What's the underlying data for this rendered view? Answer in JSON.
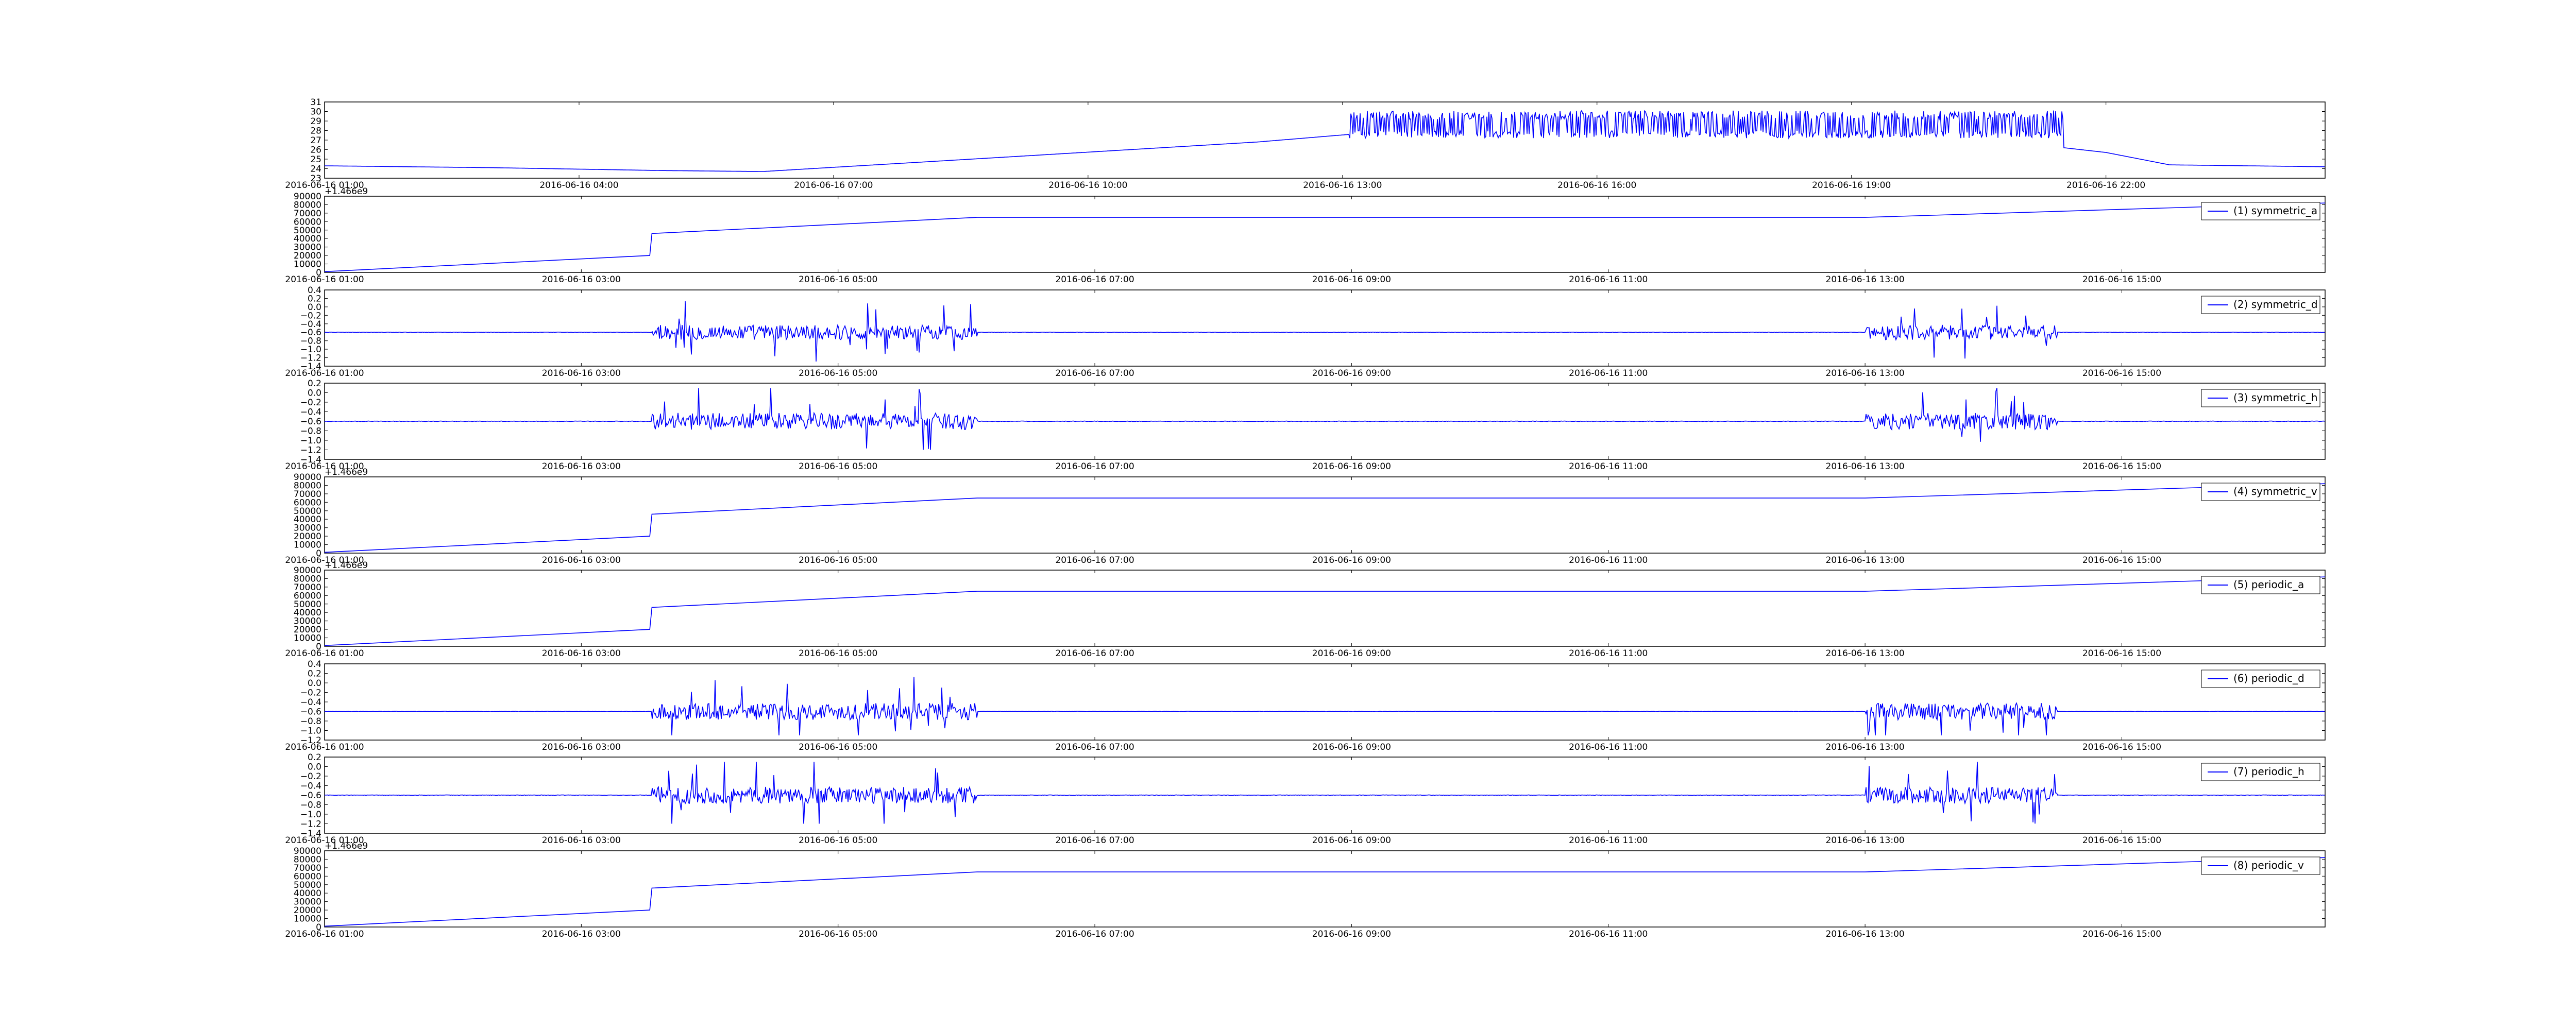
{
  "colors": {
    "line": "#0000ff",
    "axes": "#000000",
    "background": "#ffffff"
  },
  "chart_data": [
    {
      "type": "line",
      "series_shape": "temperature",
      "xlabel": "",
      "ylabel": "",
      "ylim": [
        23,
        31
      ],
      "yticks": [
        23,
        24,
        25,
        26,
        27,
        28,
        29,
        30,
        31
      ],
      "xlim": [
        "2016-06-16 01:00",
        "2016-06-17 00:35"
      ],
      "xticks": [
        "2016-06-16 01:00",
        "2016-06-16 04:00",
        "2016-06-16 07:00",
        "2016-06-16 10:00",
        "2016-06-16 13:00",
        "2016-06-16 16:00",
        "2016-06-16 19:00",
        "2016-06-16 22:00"
      ],
      "legend": null,
      "grid": false,
      "x": [
        "2016-06-16 01:00",
        "2016-06-16 03:00",
        "2016-06-16 05:00",
        "2016-06-16 06:10",
        "2016-06-16 09:00",
        "2016-06-16 12:00",
        "2016-06-16 13:05",
        "2016-06-16 17:00",
        "2016-06-16 20:30",
        "2016-06-16 21:30",
        "2016-06-16 22:00",
        "2016-06-16 22:45",
        "2016-06-17 00:35"
      ],
      "values": [
        24.3,
        24.1,
        23.8,
        23.7,
        25.2,
        26.8,
        27.6,
        28.5,
        28.8,
        26.2,
        25.7,
        24.4,
        24.2
      ]
    },
    {
      "type": "line",
      "series_shape": "ramp",
      "offset_label": "+1.466e9",
      "ylim": [
        0,
        90000
      ],
      "yticks": [
        0,
        10000,
        20000,
        30000,
        40000,
        50000,
        60000,
        70000,
        80000,
        90000
      ],
      "xlim": [
        "2016-06-16 01:00",
        "2016-06-16 16:35"
      ],
      "xticks": [
        "2016-06-16 01:00",
        "2016-06-16 03:00",
        "2016-06-16 05:00",
        "2016-06-16 07:00",
        "2016-06-16 09:00",
        "2016-06-16 11:00",
        "2016-06-16 13:00",
        "2016-06-16 15:00"
      ],
      "legend": {
        "label": "(1) symmetric_a",
        "position": "upper-right"
      },
      "x": [
        "2016-06-16 01:00",
        "2016-06-16 03:32",
        "2016-06-16 03:33",
        "2016-06-16 06:05",
        "2016-06-16 13:00",
        "2016-06-16 16:35"
      ],
      "values": [
        1000,
        20000,
        46000,
        65000,
        65000,
        82000
      ]
    },
    {
      "type": "line",
      "series_shape": "noise",
      "ylim": [
        -1.4,
        0.4
      ],
      "yticks": [
        -1.4,
        -1.2,
        -1.0,
        -0.8,
        -0.6,
        -0.4,
        -0.2,
        0.0,
        0.2,
        0.4
      ],
      "xlim": [
        "2016-06-16 01:00",
        "2016-06-16 16:35"
      ],
      "xticks": [
        "2016-06-16 01:00",
        "2016-06-16 03:00",
        "2016-06-16 05:00",
        "2016-06-16 07:00",
        "2016-06-16 09:00",
        "2016-06-16 11:00",
        "2016-06-16 13:00",
        "2016-06-16 15:00"
      ],
      "legend": {
        "label": "(2) symmetric_d",
        "position": "upper-right"
      },
      "baseline": -0.6,
      "active_ranges": [
        [
          "2016-06-16 03:33",
          "2016-06-16 06:05"
        ],
        [
          "2016-06-16 13:00",
          "2016-06-16 14:30"
        ]
      ],
      "peak_max": 0.2,
      "peak_min": -1.3
    },
    {
      "type": "line",
      "series_shape": "noise",
      "ylim": [
        -1.4,
        0.2
      ],
      "yticks": [
        -1.4,
        -1.2,
        -1.0,
        -0.8,
        -0.6,
        -0.4,
        -0.2,
        0.0,
        0.2
      ],
      "xlim": [
        "2016-06-16 01:00",
        "2016-06-16 16:35"
      ],
      "xticks": [
        "2016-06-16 01:00",
        "2016-06-16 03:00",
        "2016-06-16 05:00",
        "2016-06-16 07:00",
        "2016-06-16 09:00",
        "2016-06-16 11:00",
        "2016-06-16 13:00",
        "2016-06-16 15:00"
      ],
      "legend": {
        "label": "(3) symmetric_h",
        "position": "upper-right"
      },
      "baseline": -0.6,
      "active_ranges": [
        [
          "2016-06-16 03:33",
          "2016-06-16 06:05"
        ],
        [
          "2016-06-16 13:00",
          "2016-06-16 14:30"
        ]
      ],
      "peak_max": 0.1,
      "peak_min": -1.2
    },
    {
      "type": "line",
      "series_shape": "ramp",
      "offset_label": "+1.466e9",
      "ylim": [
        0,
        90000
      ],
      "yticks": [
        0,
        10000,
        20000,
        30000,
        40000,
        50000,
        60000,
        70000,
        80000,
        90000
      ],
      "xlim": [
        "2016-06-16 01:00",
        "2016-06-16 16:35"
      ],
      "xticks": [
        "2016-06-16 01:00",
        "2016-06-16 03:00",
        "2016-06-16 05:00",
        "2016-06-16 07:00",
        "2016-06-16 09:00",
        "2016-06-16 11:00",
        "2016-06-16 13:00",
        "2016-06-16 15:00"
      ],
      "legend": {
        "label": "(4) symmetric_v",
        "position": "upper-right"
      },
      "x": [
        "2016-06-16 01:00",
        "2016-06-16 03:32",
        "2016-06-16 03:33",
        "2016-06-16 06:05",
        "2016-06-16 13:00",
        "2016-06-16 16:35"
      ],
      "values": [
        1000,
        20000,
        46000,
        65000,
        65000,
        82000
      ]
    },
    {
      "type": "line",
      "series_shape": "ramp",
      "offset_label": "+1.466e9",
      "ylim": [
        0,
        90000
      ],
      "yticks": [
        0,
        10000,
        20000,
        30000,
        40000,
        50000,
        60000,
        70000,
        80000,
        90000
      ],
      "xlim": [
        "2016-06-16 01:00",
        "2016-06-16 16:35"
      ],
      "xticks": [
        "2016-06-16 01:00",
        "2016-06-16 03:00",
        "2016-06-16 05:00",
        "2016-06-16 07:00",
        "2016-06-16 09:00",
        "2016-06-16 11:00",
        "2016-06-16 13:00",
        "2016-06-16 15:00"
      ],
      "legend": {
        "label": "(5) periodic_a",
        "position": "upper-right"
      },
      "x": [
        "2016-06-16 01:00",
        "2016-06-16 03:32",
        "2016-06-16 03:33",
        "2016-06-16 06:05",
        "2016-06-16 13:00",
        "2016-06-16 16:35"
      ],
      "values": [
        1000,
        20000,
        46000,
        65000,
        65000,
        82000
      ]
    },
    {
      "type": "line",
      "series_shape": "noise",
      "ylim": [
        -1.2,
        0.4
      ],
      "yticks": [
        -1.2,
        -1.0,
        -0.8,
        -0.6,
        -0.4,
        -0.2,
        0.0,
        0.2,
        0.4
      ],
      "xlim": [
        "2016-06-16 01:00",
        "2016-06-16 16:35"
      ],
      "xticks": [
        "2016-06-16 01:00",
        "2016-06-16 03:00",
        "2016-06-16 05:00",
        "2016-06-16 07:00",
        "2016-06-16 09:00",
        "2016-06-16 11:00",
        "2016-06-16 13:00",
        "2016-06-16 15:00"
      ],
      "legend": {
        "label": "(6) periodic_d",
        "position": "upper-right"
      },
      "baseline": -0.6,
      "active_ranges": [
        [
          "2016-06-16 03:33",
          "2016-06-16 06:05"
        ],
        [
          "2016-06-16 13:00",
          "2016-06-16 14:30"
        ]
      ],
      "peak_max": 0.3,
      "peak_min": -1.1
    },
    {
      "type": "line",
      "series_shape": "noise",
      "ylim": [
        -1.4,
        0.2
      ],
      "yticks": [
        -1.4,
        -1.2,
        -1.0,
        -0.8,
        -0.6,
        -0.4,
        -0.2,
        0.0,
        0.2
      ],
      "xlim": [
        "2016-06-16 01:00",
        "2016-06-16 16:35"
      ],
      "xticks": [
        "2016-06-16 01:00",
        "2016-06-16 03:00",
        "2016-06-16 05:00",
        "2016-06-16 07:00",
        "2016-06-16 09:00",
        "2016-06-16 11:00",
        "2016-06-16 13:00",
        "2016-06-16 15:00"
      ],
      "legend": {
        "label": "(7) periodic_h",
        "position": "upper-right"
      },
      "baseline": -0.6,
      "active_ranges": [
        [
          "2016-06-16 03:33",
          "2016-06-16 06:05"
        ],
        [
          "2016-06-16 13:00",
          "2016-06-16 14:30"
        ]
      ],
      "peak_max": 0.1,
      "peak_min": -1.2
    },
    {
      "type": "line",
      "series_shape": "ramp",
      "offset_label": "+1.466e9",
      "ylim": [
        0,
        90000
      ],
      "yticks": [
        0,
        10000,
        20000,
        30000,
        40000,
        50000,
        60000,
        70000,
        80000,
        90000
      ],
      "xlim": [
        "2016-06-16 01:00",
        "2016-06-16 16:35"
      ],
      "xticks": [
        "2016-06-16 01:00",
        "2016-06-16 03:00",
        "2016-06-16 05:00",
        "2016-06-16 07:00",
        "2016-06-16 09:00",
        "2016-06-16 11:00",
        "2016-06-16 13:00",
        "2016-06-16 15:00"
      ],
      "legend": {
        "label": "(8) periodic_v",
        "position": "upper-right"
      },
      "x": [
        "2016-06-16 01:00",
        "2016-06-16 03:32",
        "2016-06-16 03:33",
        "2016-06-16 06:05",
        "2016-06-16 13:00",
        "2016-06-16 16:35"
      ],
      "values": [
        1000,
        20000,
        46000,
        65000,
        65000,
        82000
      ]
    }
  ]
}
